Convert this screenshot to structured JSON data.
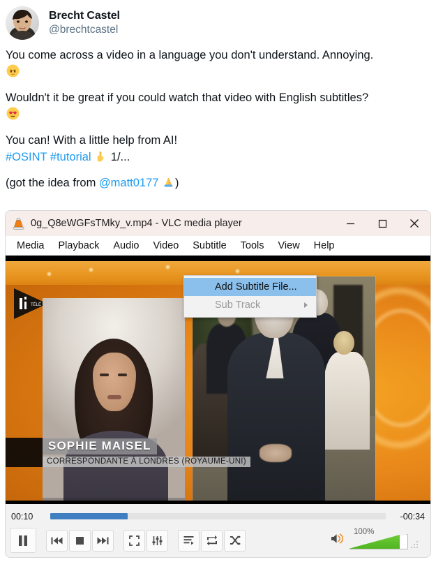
{
  "tweet": {
    "display_name": "Brecht Castel",
    "handle": "@brechtcastel",
    "avatar_name": "profile-photo",
    "paragraphs": [
      {
        "id": "p1",
        "text": "You come across a video in a language you don't understand. Annoying.",
        "emoji": "angry-face"
      },
      {
        "id": "p2",
        "text": "Wouldn't it be great if you could watch that video with English subtitles?",
        "emoji": "smiling-face-with-hearts"
      }
    ],
    "line3": "You can! With a little help from AI!",
    "hashtag_1": "#OSINT",
    "hashtag_2": "#tutorial",
    "pointer_emoji": "backhand-index-pointing-down",
    "thread_counter": "1/...",
    "credit_prefix": "(got the idea from ",
    "credit_mention": "@matt0177",
    "credit_emoji": "folded-hands",
    "credit_suffix": ")",
    "link_color": "#1d9bf0"
  },
  "vlc": {
    "title": "0g_Q8eWGFsTMky_v.mp4 - VLC media player",
    "logo_name": "vlc-cone-icon",
    "window_buttons": {
      "minimize": "—",
      "maximize": "□",
      "close": "✕"
    },
    "menu": [
      {
        "label": "Media",
        "active": false
      },
      {
        "label": "Playback",
        "active": false
      },
      {
        "label": "Audio",
        "active": false
      },
      {
        "label": "Video",
        "active": false
      },
      {
        "label": "Subtitle",
        "active": true
      },
      {
        "label": "Tools",
        "active": false
      },
      {
        "label": "View",
        "active": false
      },
      {
        "label": "Help",
        "active": false
      }
    ],
    "dropdown": {
      "open_menu": "Subtitle",
      "items": [
        {
          "label": "Add Subtitle File...",
          "state": "highlighted",
          "submenu": false
        },
        {
          "label": "Sub Track",
          "state": "disabled",
          "submenu": true
        }
      ],
      "highlight_color": "#8cc0ec"
    },
    "video": {
      "channel_logo": "i TELE",
      "lower_third_name": "SOPHIE MAISEL",
      "lower_third_subtitle": "CORRESPONDANTE À LONDRES (ROYAUME-UNI)"
    },
    "controls": {
      "elapsed": "00:10",
      "remaining": "-00:34",
      "progress_percent": 23,
      "progress_color": "#3f7fc1",
      "volume_label": "100%",
      "volume_percent": 100,
      "volume_color": "#4fb521",
      "buttons": [
        {
          "name": "pause-button",
          "label": "Pause"
        },
        {
          "name": "previous-button",
          "label": "Previous"
        },
        {
          "name": "stop-button",
          "label": "Stop"
        },
        {
          "name": "next-button",
          "label": "Next"
        },
        {
          "name": "fullscreen-button",
          "label": "Toggle fullscreen"
        },
        {
          "name": "extended-settings-button",
          "label": "Show extended settings"
        },
        {
          "name": "playlist-button",
          "label": "Show playlist"
        },
        {
          "name": "loop-button",
          "label": "Loop"
        },
        {
          "name": "shuffle-button",
          "label": "Random"
        },
        {
          "name": "mute-button",
          "label": "Mute"
        }
      ]
    }
  }
}
